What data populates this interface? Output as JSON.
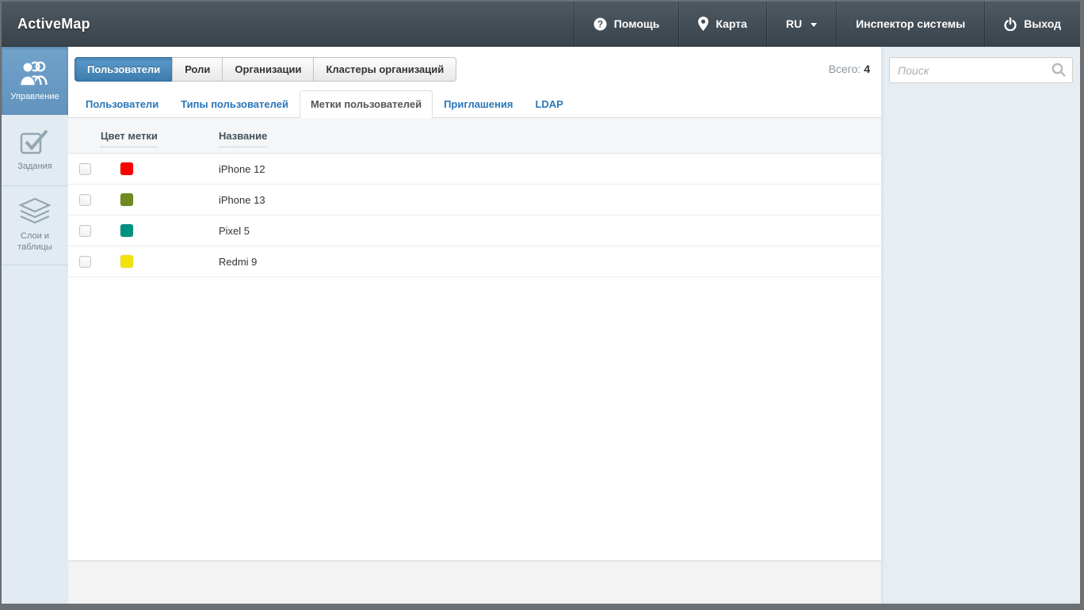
{
  "header": {
    "app_title": "ActiveMap",
    "nav": [
      {
        "label": "Помощь",
        "icon": "help-icon"
      },
      {
        "label": "Карта",
        "icon": "map-pin-icon"
      },
      {
        "label": "RU",
        "icon": "caret-down-icon"
      },
      {
        "label": "Инспектор системы"
      },
      {
        "label": "Выход",
        "icon": "power-icon"
      }
    ]
  },
  "sidebar": {
    "items": [
      {
        "label": "Управление",
        "icon": "users-icon",
        "active": true
      },
      {
        "label": "Задания",
        "icon": "tasks-icon",
        "active": false
      },
      {
        "label": "Слои и таблицы",
        "icon": "layers-icon",
        "active": false
      }
    ]
  },
  "tabs": {
    "items": [
      {
        "label": "Пользователи",
        "active": true
      },
      {
        "label": "Роли",
        "active": false
      },
      {
        "label": "Организации",
        "active": false
      },
      {
        "label": "Кластеры организаций",
        "active": false
      }
    ]
  },
  "total": {
    "label": "Всего:",
    "value": "4"
  },
  "subtabs": {
    "items": [
      {
        "label": "Пользователи",
        "active": false
      },
      {
        "label": "Типы пользователей",
        "active": false
      },
      {
        "label": "Метки пользователей",
        "active": true
      },
      {
        "label": "Приглашения",
        "active": false
      },
      {
        "label": "LDAP",
        "active": false
      }
    ]
  },
  "table": {
    "columns": [
      "Цвет метки",
      "Название"
    ],
    "rows": [
      {
        "color": "#fb0000",
        "name": "iPhone 12"
      },
      {
        "color": "#6f8a1f",
        "name": "iPhone 13"
      },
      {
        "color": "#019180",
        "name": "Pixel 5"
      },
      {
        "color": "#f0e30e",
        "name": "Redmi 9"
      }
    ]
  },
  "search": {
    "placeholder": "Поиск",
    "icon": "search-icon"
  },
  "colors": {
    "accent_blue": "#4a8fc2",
    "link_blue": "#2a76b9",
    "header_dark": "#39434b"
  }
}
